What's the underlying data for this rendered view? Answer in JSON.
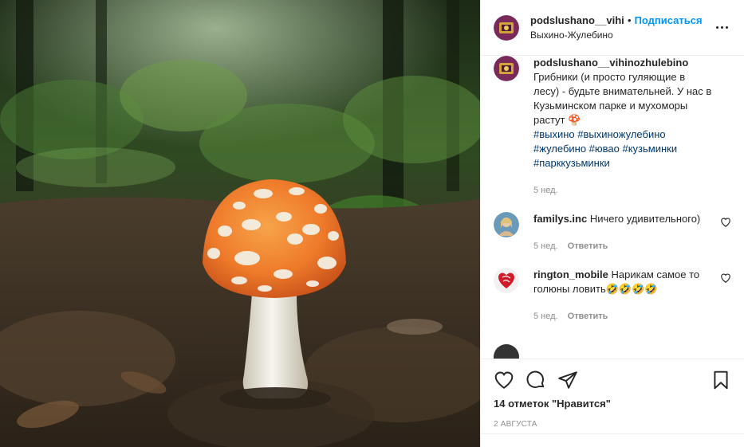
{
  "post": {
    "image_alt": "Мухомор в лесу",
    "header": {
      "username": "podslushano__vihinozhulebino",
      "separator": "•",
      "follow_label": "Подписаться",
      "location": "Выхино-Жулебино",
      "more_icon": "more-horizontal-icon"
    },
    "caption": {
      "username": "podslushano__vihinozhulebino",
      "text": "Грибники (и просто гуляющие в лесу) - будьте внимательней. У нас в Кузьминском парке и мухоморы растут 🍄",
      "hashtags": "#выхино #выхиножулебино #жулебино #ювао #кузьминки #парккузьминки",
      "time": "5 нед."
    },
    "comments": [
      {
        "username": "familys.inc",
        "text": "Ничего удивительного)",
        "time": "5 нед.",
        "reply_label": "Ответить"
      },
      {
        "username": "rington_mobile",
        "text": "Нарикам самое то голюны ловить🤣🤣🤣🤣",
        "time": "5 нед.",
        "reply_label": "Ответить"
      }
    ],
    "actions": {
      "like_icon": "heart-icon",
      "comment_icon": "comment-icon",
      "share_icon": "share-icon",
      "save_icon": "bookmark-icon"
    },
    "likes": "14 отметок \"Нравится\"",
    "date": "2 августа"
  },
  "colors": {
    "follow_blue": "#0095f6",
    "hashtag_blue": "#00376b",
    "muted_gray": "#8e8e8e",
    "text": "#262626"
  }
}
